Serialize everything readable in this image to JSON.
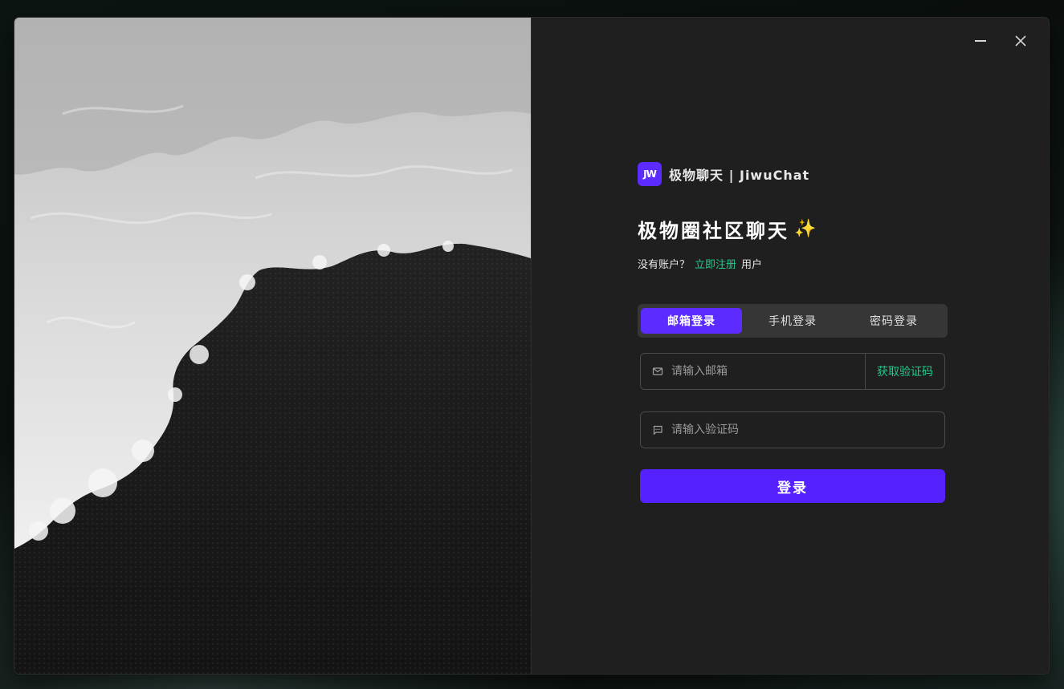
{
  "window": {
    "controls": {
      "minimize_icon": "minimize-icon",
      "close_icon": "close-icon"
    }
  },
  "brand": {
    "logo_text": "JW",
    "name": "极物聊天 | JiwuChat"
  },
  "main": {
    "title": "极物圈社区聊天",
    "title_emoji": "✨",
    "signup_prefix": "没有账户？",
    "signup_link": "立即注册",
    "signup_suffix": "用户"
  },
  "tabs": [
    {
      "label": "邮箱登录",
      "active": true
    },
    {
      "label": "手机登录",
      "active": false
    },
    {
      "label": "密码登录",
      "active": false
    }
  ],
  "form": {
    "email_placeholder": "请输入邮箱",
    "email_icon": "mail-icon",
    "get_code_label": "获取验证码",
    "code_placeholder": "请输入验证码",
    "code_icon": "message-icon",
    "login_label": "登录"
  },
  "colors": {
    "accent": "#5522ff",
    "link": "#23c98a",
    "window_bg": "#1f1f1f"
  }
}
